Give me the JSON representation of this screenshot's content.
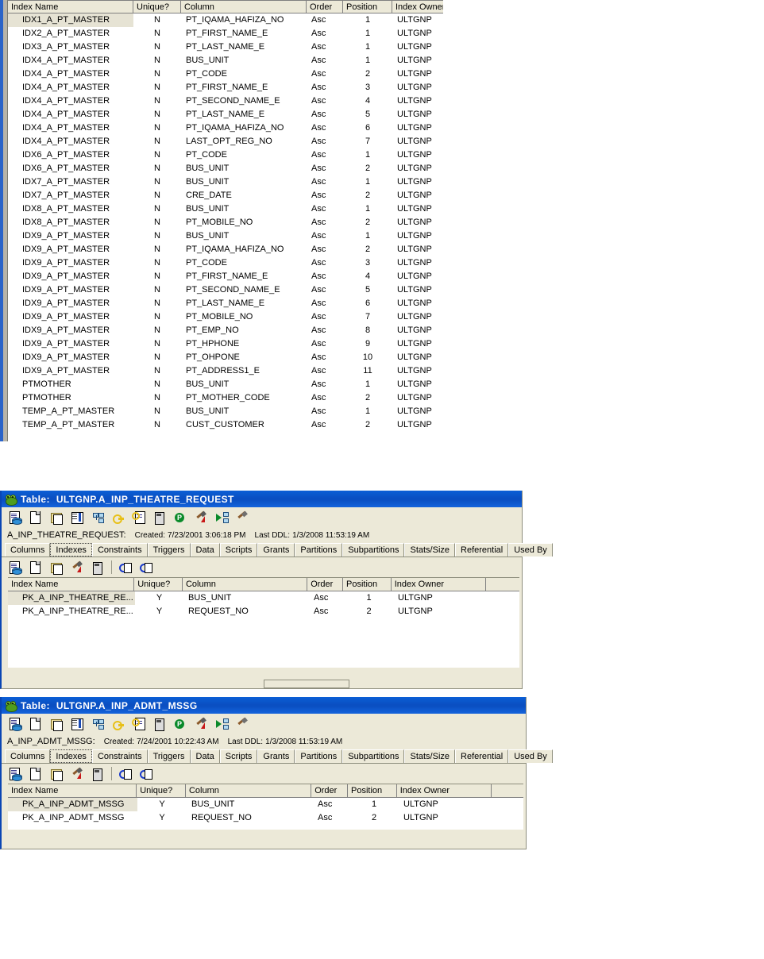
{
  "grid_columns": [
    "Index Name",
    "Unique?",
    "Column",
    "Order",
    "Position",
    "Index Owner"
  ],
  "window1": {
    "rows": [
      {
        "index_name": "IDX1_A_PT_MASTER",
        "unique": "N",
        "column": "PT_IQAMA_HAFIZA_NO",
        "order": "Asc",
        "position": "1",
        "owner": "ULTGNP",
        "selected": true
      },
      {
        "index_name": "IDX2_A_PT_MASTER",
        "unique": "N",
        "column": "PT_FIRST_NAME_E",
        "order": "Asc",
        "position": "1",
        "owner": "ULTGNP"
      },
      {
        "index_name": "IDX3_A_PT_MASTER",
        "unique": "N",
        "column": "PT_LAST_NAME_E",
        "order": "Asc",
        "position": "1",
        "owner": "ULTGNP"
      },
      {
        "index_name": "IDX4_A_PT_MASTER",
        "unique": "N",
        "column": "BUS_UNIT",
        "order": "Asc",
        "position": "1",
        "owner": "ULTGNP"
      },
      {
        "index_name": "IDX4_A_PT_MASTER",
        "unique": "N",
        "column": "PT_CODE",
        "order": "Asc",
        "position": "2",
        "owner": "ULTGNP"
      },
      {
        "index_name": "IDX4_A_PT_MASTER",
        "unique": "N",
        "column": "PT_FIRST_NAME_E",
        "order": "Asc",
        "position": "3",
        "owner": "ULTGNP"
      },
      {
        "index_name": "IDX4_A_PT_MASTER",
        "unique": "N",
        "column": "PT_SECOND_NAME_E",
        "order": "Asc",
        "position": "4",
        "owner": "ULTGNP"
      },
      {
        "index_name": "IDX4_A_PT_MASTER",
        "unique": "N",
        "column": "PT_LAST_NAME_E",
        "order": "Asc",
        "position": "5",
        "owner": "ULTGNP"
      },
      {
        "index_name": "IDX4_A_PT_MASTER",
        "unique": "N",
        "column": "PT_IQAMA_HAFIZA_NO",
        "order": "Asc",
        "position": "6",
        "owner": "ULTGNP"
      },
      {
        "index_name": "IDX4_A_PT_MASTER",
        "unique": "N",
        "column": "LAST_OPT_REG_NO",
        "order": "Asc",
        "position": "7",
        "owner": "ULTGNP"
      },
      {
        "index_name": "IDX6_A_PT_MASTER",
        "unique": "N",
        "column": "PT_CODE",
        "order": "Asc",
        "position": "1",
        "owner": "ULTGNP"
      },
      {
        "index_name": "IDX6_A_PT_MASTER",
        "unique": "N",
        "column": "BUS_UNIT",
        "order": "Asc",
        "position": "2",
        "owner": "ULTGNP"
      },
      {
        "index_name": "IDX7_A_PT_MASTER",
        "unique": "N",
        "column": "BUS_UNIT",
        "order": "Asc",
        "position": "1",
        "owner": "ULTGNP"
      },
      {
        "index_name": "IDX7_A_PT_MASTER",
        "unique": "N",
        "column": "CRE_DATE",
        "order": "Asc",
        "position": "2",
        "owner": "ULTGNP"
      },
      {
        "index_name": "IDX8_A_PT_MASTER",
        "unique": "N",
        "column": "BUS_UNIT",
        "order": "Asc",
        "position": "1",
        "owner": "ULTGNP"
      },
      {
        "index_name": "IDX8_A_PT_MASTER",
        "unique": "N",
        "column": "PT_MOBILE_NO",
        "order": "Asc",
        "position": "2",
        "owner": "ULTGNP"
      },
      {
        "index_name": "IDX9_A_PT_MASTER",
        "unique": "N",
        "column": "BUS_UNIT",
        "order": "Asc",
        "position": "1",
        "owner": "ULTGNP"
      },
      {
        "index_name": "IDX9_A_PT_MASTER",
        "unique": "N",
        "column": "PT_IQAMA_HAFIZA_NO",
        "order": "Asc",
        "position": "2",
        "owner": "ULTGNP"
      },
      {
        "index_name": "IDX9_A_PT_MASTER",
        "unique": "N",
        "column": "PT_CODE",
        "order": "Asc",
        "position": "3",
        "owner": "ULTGNP"
      },
      {
        "index_name": "IDX9_A_PT_MASTER",
        "unique": "N",
        "column": "PT_FIRST_NAME_E",
        "order": "Asc",
        "position": "4",
        "owner": "ULTGNP"
      },
      {
        "index_name": "IDX9_A_PT_MASTER",
        "unique": "N",
        "column": "PT_SECOND_NAME_E",
        "order": "Asc",
        "position": "5",
        "owner": "ULTGNP"
      },
      {
        "index_name": "IDX9_A_PT_MASTER",
        "unique": "N",
        "column": "PT_LAST_NAME_E",
        "order": "Asc",
        "position": "6",
        "owner": "ULTGNP"
      },
      {
        "index_name": "IDX9_A_PT_MASTER",
        "unique": "N",
        "column": "PT_MOBILE_NO",
        "order": "Asc",
        "position": "7",
        "owner": "ULTGNP"
      },
      {
        "index_name": "IDX9_A_PT_MASTER",
        "unique": "N",
        "column": "PT_EMP_NO",
        "order": "Asc",
        "position": "8",
        "owner": "ULTGNP"
      },
      {
        "index_name": "IDX9_A_PT_MASTER",
        "unique": "N",
        "column": "PT_HPHONE",
        "order": "Asc",
        "position": "9",
        "owner": "ULTGNP"
      },
      {
        "index_name": "IDX9_A_PT_MASTER",
        "unique": "N",
        "column": "PT_OHPONE",
        "order": "Asc",
        "position": "10",
        "owner": "ULTGNP"
      },
      {
        "index_name": "IDX9_A_PT_MASTER",
        "unique": "N",
        "column": "PT_ADDRESS1_E",
        "order": "Asc",
        "position": "11",
        "owner": "ULTGNP"
      },
      {
        "index_name": "PTMOTHER",
        "unique": "N",
        "column": "BUS_UNIT",
        "order": "Asc",
        "position": "1",
        "owner": "ULTGNP"
      },
      {
        "index_name": "PTMOTHER",
        "unique": "N",
        "column": "PT_MOTHER_CODE",
        "order": "Asc",
        "position": "2",
        "owner": "ULTGNP"
      },
      {
        "index_name": "TEMP_A_PT_MASTER",
        "unique": "N",
        "column": "BUS_UNIT",
        "order": "Asc",
        "position": "1",
        "owner": "ULTGNP"
      },
      {
        "index_name": "TEMP_A_PT_MASTER",
        "unique": "N",
        "column": "CUST_CUSTOMER",
        "order": "Asc",
        "position": "2",
        "owner": "ULTGNP"
      }
    ]
  },
  "window2": {
    "title_prefix": "Table:",
    "title": "ULTGNP.A_INP_THEATRE_REQUEST",
    "info_name": "A_INP_THEATRE_REQUEST:",
    "info_created_label": "Created:",
    "info_created": "7/23/2001 3:06:18 PM",
    "info_ddl_label": "Last DDL:",
    "info_ddl": "1/3/2008 11:53:19 AM",
    "tabs": [
      "Columns",
      "Indexes",
      "Constraints",
      "Triggers",
      "Data",
      "Scripts",
      "Grants",
      "Partitions",
      "Subpartitions",
      "Stats/Size",
      "Referential",
      "Used By"
    ],
    "active_tab": "Indexes",
    "rows": [
      {
        "index_name": "PK_A_INP_THEATRE_RE...",
        "unique": "Y",
        "column": "BUS_UNIT",
        "order": "Asc",
        "position": "1",
        "owner": "ULTGNP",
        "selected": true
      },
      {
        "index_name": "PK_A_INP_THEATRE_RE...",
        "unique": "Y",
        "column": "REQUEST_NO",
        "order": "Asc",
        "position": "2",
        "owner": "ULTGNP"
      }
    ]
  },
  "window3": {
    "title_prefix": "Table:",
    "title": "ULTGNP.A_INP_ADMT_MSSG",
    "info_name": "A_INP_ADMT_MSSG:",
    "info_created_label": "Created:",
    "info_created": "7/24/2001 10:22:43 AM",
    "info_ddl_label": "Last DDL:",
    "info_ddl": "1/3/2008 11:53:19 AM",
    "tabs": [
      "Columns",
      "Indexes",
      "Constraints",
      "Triggers",
      "Data",
      "Scripts",
      "Grants",
      "Partitions",
      "Subpartitions",
      "Stats/Size",
      "Referential",
      "Used By"
    ],
    "active_tab": "Indexes",
    "rows": [
      {
        "index_name": "PK_A_INP_ADMT_MSSG",
        "unique": "Y",
        "column": "BUS_UNIT",
        "order": "Asc",
        "position": "1",
        "owner": "ULTGNP",
        "selected": true
      },
      {
        "index_name": "PK_A_INP_ADMT_MSSG",
        "unique": "Y",
        "column": "REQUEST_NO",
        "order": "Asc",
        "position": "2",
        "owner": "ULTGNP"
      }
    ]
  },
  "toolbar_icons": [
    "describe-table-icon",
    "new-document-icon",
    "copy-object-icon",
    "columns-view-icon",
    "er-diagram-icon",
    "key-search-icon",
    "analyze-table-icon",
    "calculator-icon",
    "explain-plan-icon",
    "rebuild-hammer-icon",
    "dependency-tree-icon",
    "hammer-tools-icon"
  ],
  "subtoolbar_icons": [
    "describe-index-icon",
    "new-index-icon",
    "copy-index-icon",
    "rebuild-index-icon",
    "calculator-icon",
    "cut-index-icon",
    "paste-index-icon"
  ],
  "colors": {
    "titlebar": "#0a4fc2",
    "chrome": "#ece9d8",
    "grid_header": "#ece9d8",
    "selection": "#e6e3d4",
    "border": "#8f8f7e"
  }
}
